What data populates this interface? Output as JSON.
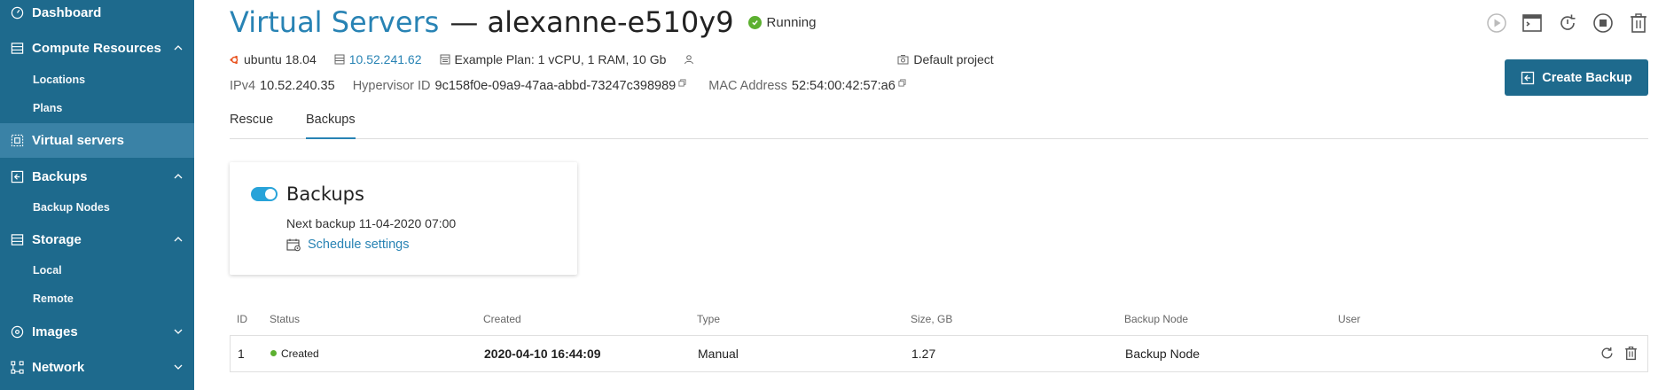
{
  "sidebar": {
    "items": [
      {
        "label": "Dashboard",
        "icon": "gauge-icon"
      },
      {
        "label": "Compute Resources",
        "icon": "server-icon",
        "chevron": "up"
      },
      {
        "label": "Virtual servers",
        "icon": "virtual-servers-icon",
        "active": true
      },
      {
        "label": "Backups",
        "icon": "backup-icon",
        "chevron": "up"
      },
      {
        "label": "Storage",
        "icon": "storage-icon",
        "chevron": "up"
      },
      {
        "label": "Images",
        "icon": "disc-icon",
        "chevron": "down"
      },
      {
        "label": "Network",
        "icon": "network-icon",
        "chevron": "down"
      }
    ],
    "compute_sub": [
      "Locations",
      "Plans"
    ],
    "backups_sub": [
      "Backup Nodes"
    ],
    "storage_sub": [
      "Local",
      "Remote"
    ]
  },
  "header": {
    "title_link": "Virtual Servers",
    "title_rest": "— alexanne-e510y9",
    "status": "Running",
    "status_color": "#5cb030"
  },
  "meta": {
    "os": "ubuntu 18.04",
    "ip": "10.52.241.62",
    "plan": "Example Plan: 1 vCPU, 1 RAM, 10 Gb",
    "project": "Default project",
    "ipv4_label": "IPv4",
    "ipv4": "10.52.240.35",
    "hypervisor_label": "Hypervisor ID",
    "hypervisor_id": "9c158f0e-09a9-47aa-abbd-73247c398989",
    "mac_label": "MAC Address",
    "mac": "52:54:00:42:57:a6"
  },
  "actions": {
    "create_backup": "Create Backup"
  },
  "tabs": [
    "Rescue",
    "Backups"
  ],
  "active_tab": "Backups",
  "backup_card": {
    "title": "Backups",
    "enabled": true,
    "next_backup": "Next backup 11-04-2020 07:00",
    "schedule_link": "Schedule settings"
  },
  "table": {
    "headers": [
      "ID",
      "Status",
      "Created",
      "Type",
      "Size, GB",
      "Backup Node",
      "User"
    ],
    "rows": [
      {
        "id": "1",
        "status": "Created",
        "created": "2020-04-10 16:44:09",
        "type": "Manual",
        "size": "1.27",
        "node": "Backup Node",
        "user": ""
      }
    ]
  },
  "colors": {
    "sidebar": "#1e6a8d",
    "accent": "#2883b4",
    "success": "#5cb030"
  }
}
